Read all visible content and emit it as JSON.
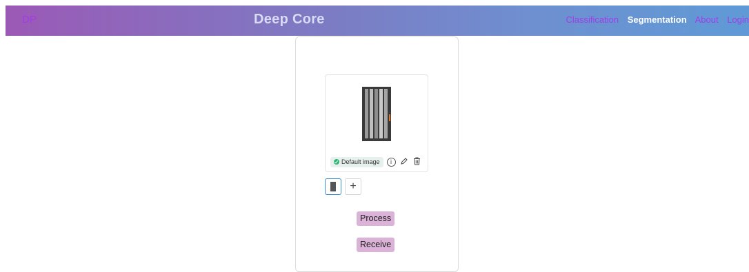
{
  "navbar": {
    "brand_short": "DP",
    "brand_title": "Deep Core",
    "links": [
      "Classification",
      "Segmentation",
      "About",
      "Login"
    ],
    "active": "Segmentation"
  },
  "uploader": {
    "badge": "Default image",
    "icons": [
      "info-icon",
      "edit-pencil-icon",
      "trash-icon"
    ],
    "add_symbol": "+"
  },
  "actions": {
    "process": "Process",
    "receive": "Receive"
  },
  "colors": {
    "brand_accent": "#a23be8",
    "button_bg": "#dcb3d8",
    "badge_ok": "#2bb673"
  }
}
